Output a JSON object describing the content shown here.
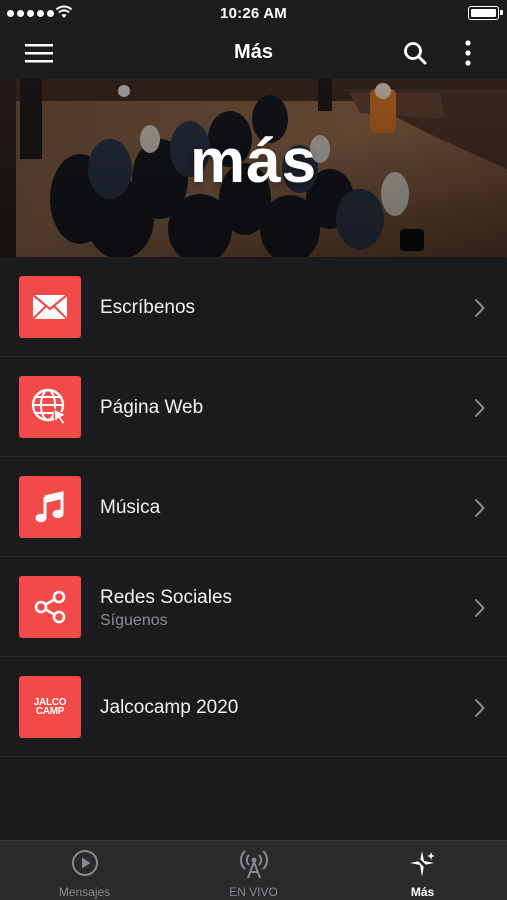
{
  "status_bar": {
    "time": "10:26 AM"
  },
  "nav": {
    "title": "Más"
  },
  "hero": {
    "title": "más"
  },
  "menu": [
    {
      "label": "Escríbenos",
      "subtitle": "",
      "icon": "envelope-icon"
    },
    {
      "label": "Página Web",
      "subtitle": "",
      "icon": "globe-cursor-icon"
    },
    {
      "label": "Música",
      "subtitle": "",
      "icon": "music-note-icon"
    },
    {
      "label": "Redes Sociales",
      "subtitle": "Síguenos",
      "icon": "share-icon"
    },
    {
      "label": "Jalcocamp 2020",
      "subtitle": "",
      "icon": "jalcocamp-logo-icon",
      "logo_text": [
        "JALCO",
        "CAMP"
      ]
    }
  ],
  "tabs": [
    {
      "label": "Mensajes",
      "icon": "play-circle-icon",
      "active": false
    },
    {
      "label": "EN VIVO",
      "icon": "broadcast-icon",
      "active": false
    },
    {
      "label": "Más",
      "icon": "sparkle-icon",
      "active": true
    }
  ],
  "colors": {
    "accent": "#f24a48",
    "background": "#1b1b1d",
    "tab_bar": "#2a2a2c"
  }
}
